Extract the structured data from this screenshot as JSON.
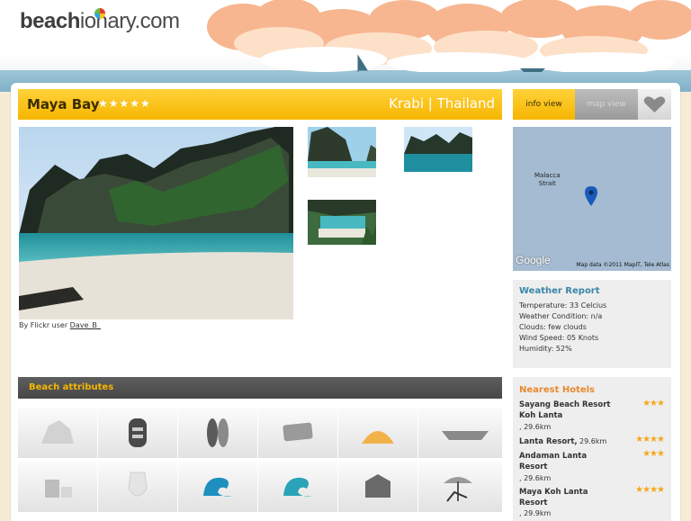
{
  "site": {
    "logo_bold": "beach",
    "logo_rest": "ionary.com"
  },
  "beach": {
    "name": "Maya Bay",
    "rating_stars": "★★★★★",
    "location": "Krabi | Thailand"
  },
  "photo_credit": {
    "prefix": "By Flickr user",
    "user": "Dave_B_"
  },
  "tabs": {
    "info": "info view",
    "map": "map view"
  },
  "map": {
    "place_label_1": "Malacca",
    "place_label_2": "Strait",
    "brand": "Google",
    "attribution": "Map data ©2011 MapIT, Tele Atlas"
  },
  "attributes": {
    "title": "Beach attributes"
  },
  "weather": {
    "title": "Weather Report",
    "lines": [
      "Temperature: 33 Celcius",
      "Weather Condition: n/a",
      "Clouds: few clouds",
      "Wind Speed: 05 Knots",
      "Humidity: 52%"
    ]
  },
  "hotels": {
    "title": "Nearest Hotels",
    "items": [
      {
        "name": "Sayang Beach Resort Koh Lanta",
        "dist": ", 29.6km",
        "stars": "★★★"
      },
      {
        "name": "Lanta Resort,",
        "dist": "29.6km",
        "stars": "★★★★"
      },
      {
        "name": "Andaman Lanta Resort",
        "dist": ", 29.6km",
        "stars": "★★★"
      },
      {
        "name": "Maya Koh Lanta Resort",
        "dist": ", 29.9km",
        "stars": "★★★★"
      }
    ]
  },
  "colors": {
    "accent": "#f6b500",
    "dark_bar": "#4f4f4f",
    "weather_title": "#3a86a8",
    "hotels_title": "#e9892d"
  }
}
